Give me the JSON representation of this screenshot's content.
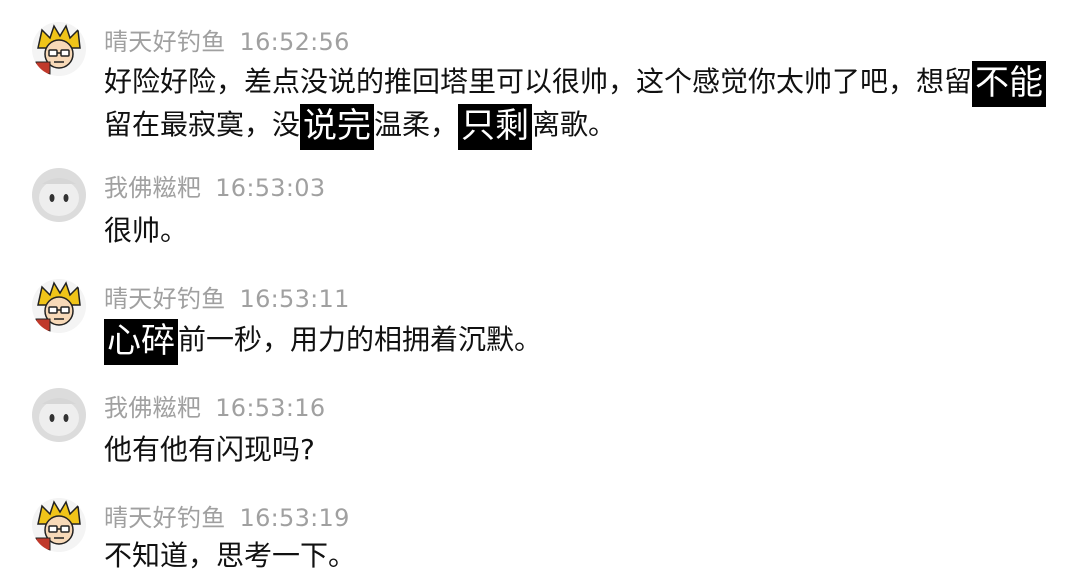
{
  "messages": [
    {
      "sender": "晴天好钓鱼",
      "time": "16:52:56",
      "avatar": "yellow-hair-character-avatar",
      "lines": [
        [
          {
            "t": "好险好险，差点没说的推回塔里可以很帅，这个感觉你太帅了吧，想留",
            "hl": false
          },
          {
            "t": "不能",
            "hl": true
          }
        ],
        [
          {
            "t": "留在最寂寞，没",
            "hl": false
          },
          {
            "t": "说完",
            "hl": true
          },
          {
            "t": "温柔，",
            "hl": false
          },
          {
            "t": "只剩",
            "hl": true
          },
          {
            "t": "离歌。",
            "hl": false
          }
        ]
      ]
    },
    {
      "sender": "我佛糍粑",
      "time": "16:53:03",
      "avatar": "gray-plush-avatar",
      "lines": [
        [
          {
            "t": "很帅。",
            "hl": false
          }
        ]
      ]
    },
    {
      "sender": "晴天好钓鱼",
      "time": "16:53:11",
      "avatar": "yellow-hair-character-avatar",
      "lines": [
        [
          {
            "t": "心碎",
            "hl": true
          },
          {
            "t": "前一秒，用力的相拥着沉默。",
            "hl": false
          }
        ]
      ]
    },
    {
      "sender": "我佛糍粑",
      "time": "16:53:16",
      "avatar": "gray-plush-avatar",
      "lines": [
        [
          {
            "t": "他有他有闪现吗?",
            "hl": false
          }
        ]
      ]
    },
    {
      "sender": "晴天好钓鱼",
      "time": "16:53:19",
      "avatar": "yellow-hair-character-avatar",
      "lines": [
        [
          {
            "t": "不知道，思考一下。",
            "hl": false
          }
        ]
      ]
    }
  ]
}
